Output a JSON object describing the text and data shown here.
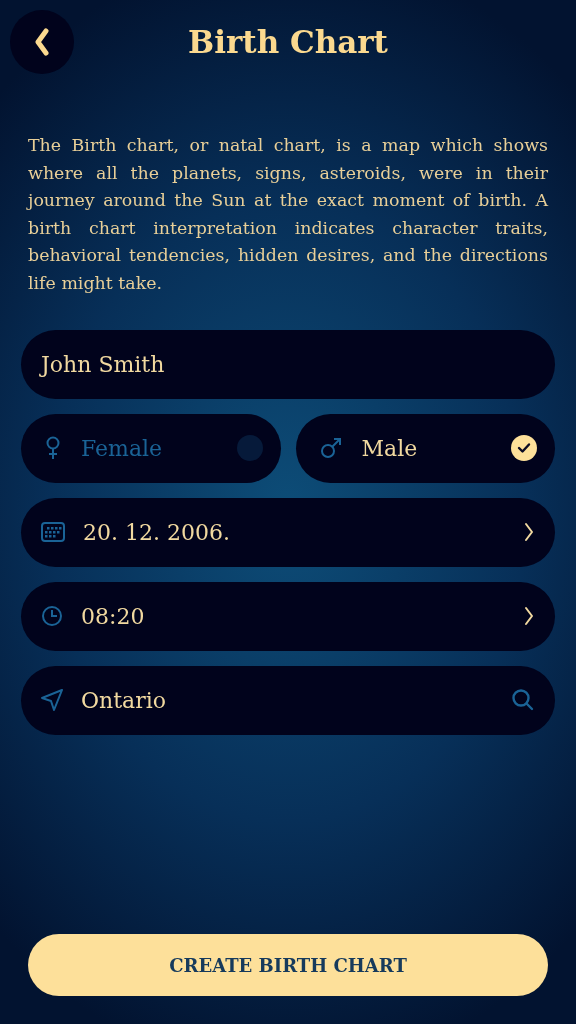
{
  "header": {
    "title": "Birth Chart"
  },
  "description": "The Birth chart, or natal chart, is a map which shows where all the planets, signs, asteroids, were in their journey around the Sun at the exact moment of birth. A birth chart interpretation indicates character traits, behavioral tendencies, hidden desires, and the directions life might take.",
  "name_field": {
    "value": "John Smith"
  },
  "gender_options": [
    {
      "kind": "female",
      "label": "Female",
      "selected": false
    },
    {
      "kind": "male",
      "label": "Male",
      "selected": true
    }
  ],
  "fields": [
    {
      "kind": "date",
      "value": "20. 12. 2006."
    },
    {
      "kind": "time",
      "value": "08:20"
    },
    {
      "kind": "location",
      "value": "Ontario"
    }
  ],
  "submit_button": {
    "label": "CREATE BIRTH CHART"
  }
}
